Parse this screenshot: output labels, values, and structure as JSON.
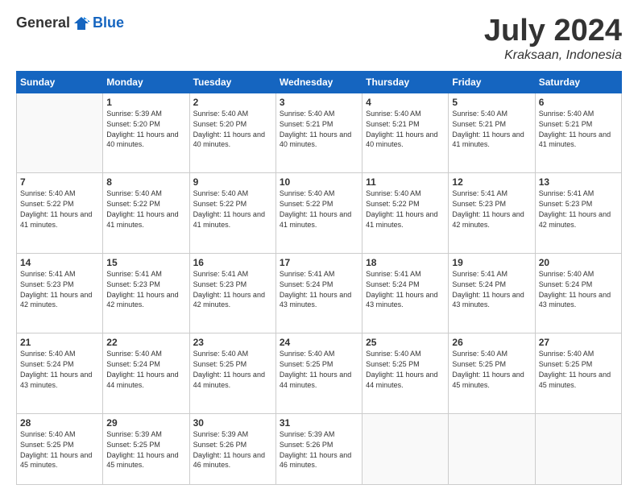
{
  "logo": {
    "text_general": "General",
    "text_blue": "Blue"
  },
  "title": {
    "month_year": "July 2024",
    "location": "Kraksaan, Indonesia"
  },
  "days_of_week": [
    "Sunday",
    "Monday",
    "Tuesday",
    "Wednesday",
    "Thursday",
    "Friday",
    "Saturday"
  ],
  "weeks": [
    [
      {
        "day": "",
        "sunrise": "",
        "sunset": "",
        "daylight": ""
      },
      {
        "day": "1",
        "sunrise": "Sunrise: 5:39 AM",
        "sunset": "Sunset: 5:20 PM",
        "daylight": "Daylight: 11 hours and 40 minutes."
      },
      {
        "day": "2",
        "sunrise": "Sunrise: 5:40 AM",
        "sunset": "Sunset: 5:20 PM",
        "daylight": "Daylight: 11 hours and 40 minutes."
      },
      {
        "day": "3",
        "sunrise": "Sunrise: 5:40 AM",
        "sunset": "Sunset: 5:21 PM",
        "daylight": "Daylight: 11 hours and 40 minutes."
      },
      {
        "day": "4",
        "sunrise": "Sunrise: 5:40 AM",
        "sunset": "Sunset: 5:21 PM",
        "daylight": "Daylight: 11 hours and 40 minutes."
      },
      {
        "day": "5",
        "sunrise": "Sunrise: 5:40 AM",
        "sunset": "Sunset: 5:21 PM",
        "daylight": "Daylight: 11 hours and 41 minutes."
      },
      {
        "day": "6",
        "sunrise": "Sunrise: 5:40 AM",
        "sunset": "Sunset: 5:21 PM",
        "daylight": "Daylight: 11 hours and 41 minutes."
      }
    ],
    [
      {
        "day": "7",
        "sunrise": "Sunrise: 5:40 AM",
        "sunset": "Sunset: 5:22 PM",
        "daylight": "Daylight: 11 hours and 41 minutes."
      },
      {
        "day": "8",
        "sunrise": "Sunrise: 5:40 AM",
        "sunset": "Sunset: 5:22 PM",
        "daylight": "Daylight: 11 hours and 41 minutes."
      },
      {
        "day": "9",
        "sunrise": "Sunrise: 5:40 AM",
        "sunset": "Sunset: 5:22 PM",
        "daylight": "Daylight: 11 hours and 41 minutes."
      },
      {
        "day": "10",
        "sunrise": "Sunrise: 5:40 AM",
        "sunset": "Sunset: 5:22 PM",
        "daylight": "Daylight: 11 hours and 41 minutes."
      },
      {
        "day": "11",
        "sunrise": "Sunrise: 5:40 AM",
        "sunset": "Sunset: 5:22 PM",
        "daylight": "Daylight: 11 hours and 41 minutes."
      },
      {
        "day": "12",
        "sunrise": "Sunrise: 5:41 AM",
        "sunset": "Sunset: 5:23 PM",
        "daylight": "Daylight: 11 hours and 42 minutes."
      },
      {
        "day": "13",
        "sunrise": "Sunrise: 5:41 AM",
        "sunset": "Sunset: 5:23 PM",
        "daylight": "Daylight: 11 hours and 42 minutes."
      }
    ],
    [
      {
        "day": "14",
        "sunrise": "Sunrise: 5:41 AM",
        "sunset": "Sunset: 5:23 PM",
        "daylight": "Daylight: 11 hours and 42 minutes."
      },
      {
        "day": "15",
        "sunrise": "Sunrise: 5:41 AM",
        "sunset": "Sunset: 5:23 PM",
        "daylight": "Daylight: 11 hours and 42 minutes."
      },
      {
        "day": "16",
        "sunrise": "Sunrise: 5:41 AM",
        "sunset": "Sunset: 5:23 PM",
        "daylight": "Daylight: 11 hours and 42 minutes."
      },
      {
        "day": "17",
        "sunrise": "Sunrise: 5:41 AM",
        "sunset": "Sunset: 5:24 PM",
        "daylight": "Daylight: 11 hours and 43 minutes."
      },
      {
        "day": "18",
        "sunrise": "Sunrise: 5:41 AM",
        "sunset": "Sunset: 5:24 PM",
        "daylight": "Daylight: 11 hours and 43 minutes."
      },
      {
        "day": "19",
        "sunrise": "Sunrise: 5:41 AM",
        "sunset": "Sunset: 5:24 PM",
        "daylight": "Daylight: 11 hours and 43 minutes."
      },
      {
        "day": "20",
        "sunrise": "Sunrise: 5:40 AM",
        "sunset": "Sunset: 5:24 PM",
        "daylight": "Daylight: 11 hours and 43 minutes."
      }
    ],
    [
      {
        "day": "21",
        "sunrise": "Sunrise: 5:40 AM",
        "sunset": "Sunset: 5:24 PM",
        "daylight": "Daylight: 11 hours and 43 minutes."
      },
      {
        "day": "22",
        "sunrise": "Sunrise: 5:40 AM",
        "sunset": "Sunset: 5:24 PM",
        "daylight": "Daylight: 11 hours and 44 minutes."
      },
      {
        "day": "23",
        "sunrise": "Sunrise: 5:40 AM",
        "sunset": "Sunset: 5:25 PM",
        "daylight": "Daylight: 11 hours and 44 minutes."
      },
      {
        "day": "24",
        "sunrise": "Sunrise: 5:40 AM",
        "sunset": "Sunset: 5:25 PM",
        "daylight": "Daylight: 11 hours and 44 minutes."
      },
      {
        "day": "25",
        "sunrise": "Sunrise: 5:40 AM",
        "sunset": "Sunset: 5:25 PM",
        "daylight": "Daylight: 11 hours and 44 minutes."
      },
      {
        "day": "26",
        "sunrise": "Sunrise: 5:40 AM",
        "sunset": "Sunset: 5:25 PM",
        "daylight": "Daylight: 11 hours and 45 minutes."
      },
      {
        "day": "27",
        "sunrise": "Sunrise: 5:40 AM",
        "sunset": "Sunset: 5:25 PM",
        "daylight": "Daylight: 11 hours and 45 minutes."
      }
    ],
    [
      {
        "day": "28",
        "sunrise": "Sunrise: 5:40 AM",
        "sunset": "Sunset: 5:25 PM",
        "daylight": "Daylight: 11 hours and 45 minutes."
      },
      {
        "day": "29",
        "sunrise": "Sunrise: 5:39 AM",
        "sunset": "Sunset: 5:25 PM",
        "daylight": "Daylight: 11 hours and 45 minutes."
      },
      {
        "day": "30",
        "sunrise": "Sunrise: 5:39 AM",
        "sunset": "Sunset: 5:26 PM",
        "daylight": "Daylight: 11 hours and 46 minutes."
      },
      {
        "day": "31",
        "sunrise": "Sunrise: 5:39 AM",
        "sunset": "Sunset: 5:26 PM",
        "daylight": "Daylight: 11 hours and 46 minutes."
      },
      {
        "day": "",
        "sunrise": "",
        "sunset": "",
        "daylight": ""
      },
      {
        "day": "",
        "sunrise": "",
        "sunset": "",
        "daylight": ""
      },
      {
        "day": "",
        "sunrise": "",
        "sunset": "",
        "daylight": ""
      }
    ]
  ]
}
